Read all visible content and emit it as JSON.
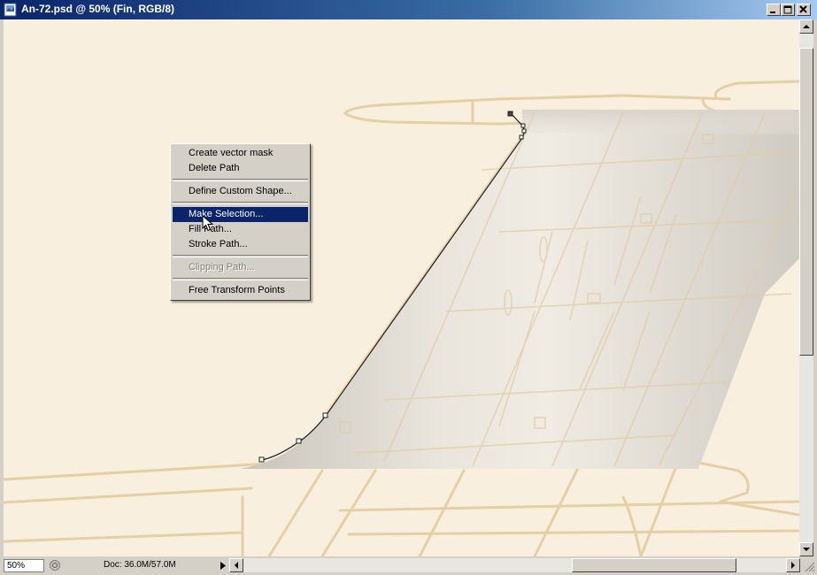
{
  "window": {
    "title": "An-72.psd @ 50% (Fin, RGB/8)"
  },
  "context_menu": {
    "items": [
      {
        "label": "Create vector mask",
        "state": "normal"
      },
      {
        "label": "Delete Path",
        "state": "normal"
      },
      {
        "separator": true
      },
      {
        "label": "Define Custom Shape...",
        "state": "normal"
      },
      {
        "separator": true
      },
      {
        "label": "Make Selection...",
        "state": "highlighted"
      },
      {
        "label": "Fill Path...",
        "state": "normal"
      },
      {
        "label": "Stroke Path...",
        "state": "normal"
      },
      {
        "separator": true
      },
      {
        "label": "Clipping Path...",
        "state": "disabled"
      },
      {
        "separator": true
      },
      {
        "label": "Free Transform Points",
        "state": "normal"
      }
    ]
  },
  "status": {
    "zoom": "50%",
    "doc": "Doc: 36.0M/57.0M"
  },
  "icons": {
    "app": "photoshop-doc-icon",
    "minimize": "minimize-icon",
    "maximize": "maximize-icon",
    "close": "close-icon"
  },
  "colors": {
    "canvas_bg": "#f8efdf",
    "blueprint_lines": "#e6cfa4",
    "menu_highlight": "#0a246a",
    "title_bar": "#0a246a"
  }
}
